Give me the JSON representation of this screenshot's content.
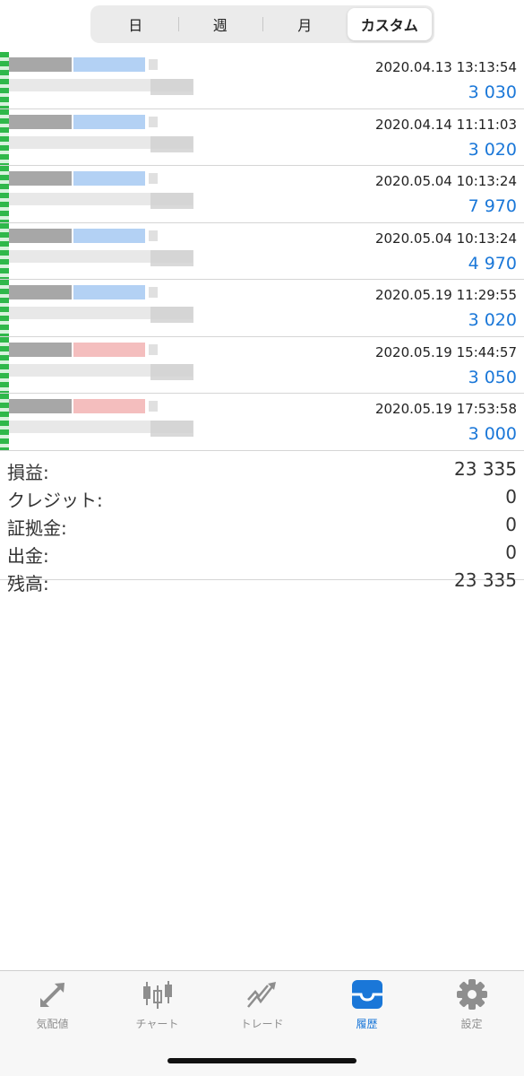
{
  "segmented": {
    "items": [
      {
        "label": "日"
      },
      {
        "label": "週"
      },
      {
        "label": "月"
      },
      {
        "label": "カスタム"
      }
    ],
    "selected": "カスタム"
  },
  "deals": [
    {
      "time": "2020.04.13 13:13:54",
      "profit": "3 030",
      "side": "buy"
    },
    {
      "time": "2020.04.14 11:11:03",
      "profit": "3 020",
      "side": "buy"
    },
    {
      "time": "2020.05.04 10:13:24",
      "profit": "7 970",
      "side": "buy"
    },
    {
      "time": "2020.05.04 10:13:24",
      "profit": "4 970",
      "side": "buy"
    },
    {
      "time": "2020.05.19 11:29:55",
      "profit": "3 020",
      "side": "buy"
    },
    {
      "time": "2020.05.19 15:44:57",
      "profit": "3 050",
      "side": "sell"
    },
    {
      "time": "2020.05.19 17:53:58",
      "profit": "3 000",
      "side": "sell"
    }
  ],
  "summary": {
    "profit_label": "損益:",
    "profit_value": "23 335",
    "credit_label": "クレジット:",
    "credit_value": "0",
    "deposit_label": "証拠金:",
    "deposit_value": "0",
    "withdrawal_label": "出金:",
    "withdrawal_value": "0",
    "balance_label": "残高:",
    "balance_value": "23 335"
  },
  "tabbar": {
    "items": [
      {
        "label": "気配値",
        "icon": "quotes-arrows-icon"
      },
      {
        "label": "チャート",
        "icon": "candlestick-chart-icon"
      },
      {
        "label": "トレード",
        "icon": "trade-line-icon"
      },
      {
        "label": "履歴",
        "icon": "history-inbox-icon"
      },
      {
        "label": "設定",
        "icon": "settings-gear-icon"
      }
    ],
    "active": "履歴"
  },
  "colors": {
    "profit_text": "#1a77d8",
    "active_tab": "#1a77d8",
    "inactive_tab": "#8e8e8e",
    "buy_marker": "#8ab8ee",
    "sell_marker": "#ee9b9b",
    "accent_bar": "#2fb84a"
  }
}
